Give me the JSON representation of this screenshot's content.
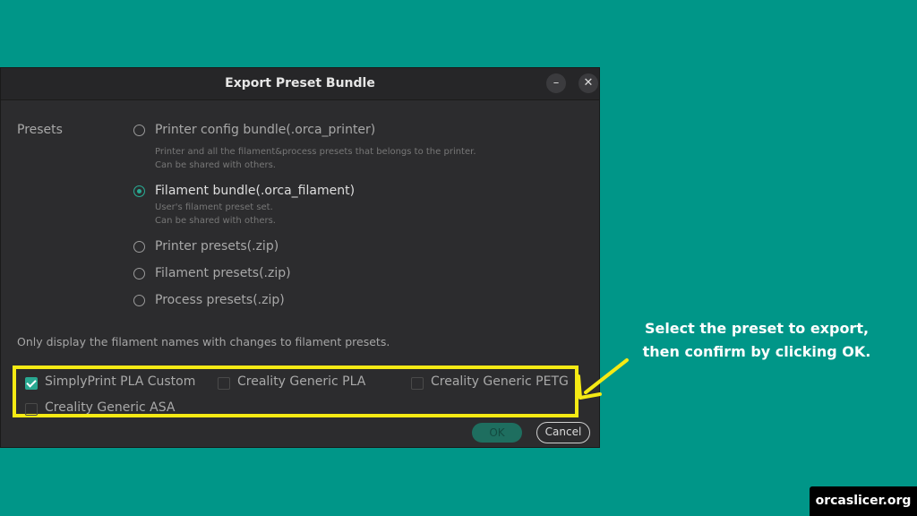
{
  "dialog": {
    "title": "Export Preset Bundle",
    "minimize_icon": "minimize-icon",
    "close_icon": "close-icon",
    "presets_label": "Presets",
    "options": [
      {
        "label": "Printer config bundle(.orca_printer)",
        "selected": false,
        "desc": [
          "Printer and all the filament&process presets that belongs to the printer.",
          "Can be shared with others."
        ]
      },
      {
        "label": "Filament bundle(.orca_filament)",
        "selected": true,
        "desc": [
          "User's filament preset set.",
          "Can be shared with others."
        ]
      },
      {
        "label": "Printer presets(.zip)",
        "selected": false
      },
      {
        "label": "Filament presets(.zip)",
        "selected": false
      },
      {
        "label": "Process presets(.zip)",
        "selected": false
      }
    ],
    "hint": "Only display the filament names with changes to filament presets.",
    "filaments": [
      {
        "label": "SimplyPrint PLA Custom",
        "checked": true
      },
      {
        "label": "Creality Generic PLA",
        "checked": false
      },
      {
        "label": "Creality Generic PETG",
        "checked": false
      },
      {
        "label": "Creality Generic ASA",
        "checked": false
      }
    ],
    "ok_label": "OK",
    "cancel_label": "Cancel"
  },
  "annotation": {
    "line1": "Select the preset to export,",
    "line2": "then confirm by clicking OK.",
    "highlight_color": "#f5ea14"
  },
  "site_badge": "orcaslicer.org",
  "colors": {
    "background": "#009688",
    "accent": "#29a891",
    "dialog": "#2c2c2e"
  }
}
